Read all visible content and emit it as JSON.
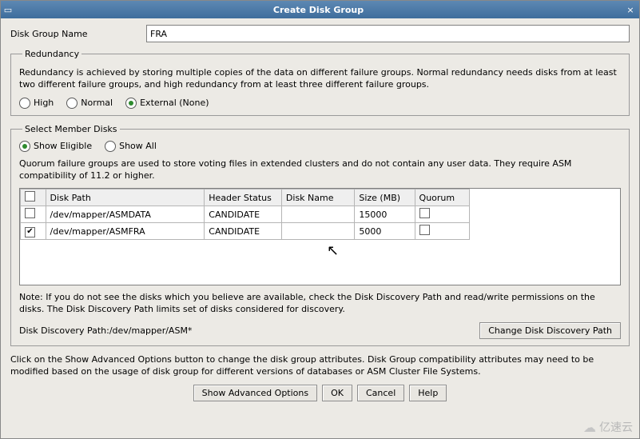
{
  "window": {
    "title": "Create Disk Group",
    "close_glyph": "×",
    "sys_glyph": "▭"
  },
  "disk_group_name": {
    "label": "Disk Group Name",
    "value": "FRA"
  },
  "redundancy": {
    "legend": "Redundancy",
    "desc": "Redundancy is achieved by storing multiple copies of the data on different failure groups. Normal redundancy needs disks from at least two different failure groups, and high redundancy from at least three different failure groups.",
    "options": {
      "high": "High",
      "normal": "Normal",
      "external": "External (None)"
    },
    "selected": "external"
  },
  "member_disks": {
    "legend": "Select Member Disks",
    "filter": {
      "show_eligible": "Show Eligible",
      "show_all": "Show All",
      "selected": "show_eligible"
    },
    "quorum_desc": "Quorum failure groups are used to store voting files in extended clusters and do not contain any user data. They require ASM compatibility of 11.2 or higher.",
    "columns": {
      "path": "Disk Path",
      "header_status": "Header Status",
      "disk_name": "Disk Name",
      "size_mb": "Size (MB)",
      "quorum": "Quorum"
    },
    "rows": [
      {
        "checked": false,
        "path": "/dev/mapper/ASMDATA",
        "header_status": "CANDIDATE",
        "disk_name": "",
        "size_mb": "15000",
        "quorum": false
      },
      {
        "checked": true,
        "path": "/dev/mapper/ASMFRA",
        "header_status": "CANDIDATE",
        "disk_name": "",
        "size_mb": "5000",
        "quorum": false
      }
    ],
    "note": "Note: If you do not see the disks which you believe are available, check the Disk Discovery Path and read/write permissions on the disks. The Disk Discovery Path limits set of disks considered for discovery.",
    "discovery_path_label": "Disk Discovery Path:",
    "discovery_path_value": "/dev/mapper/ASM*",
    "change_path_button": "Change Disk Discovery Path"
  },
  "bottom": {
    "desc": "Click on the Show Advanced Options button to change the disk group attributes. Disk Group compatibility attributes may need to be modified based on the usage of disk group for different versions of databases or ASM Cluster File Systems.",
    "buttons": {
      "advanced": "Show Advanced Options",
      "ok": "OK",
      "cancel": "Cancel",
      "help": "Help"
    }
  },
  "watermark": "亿速云"
}
